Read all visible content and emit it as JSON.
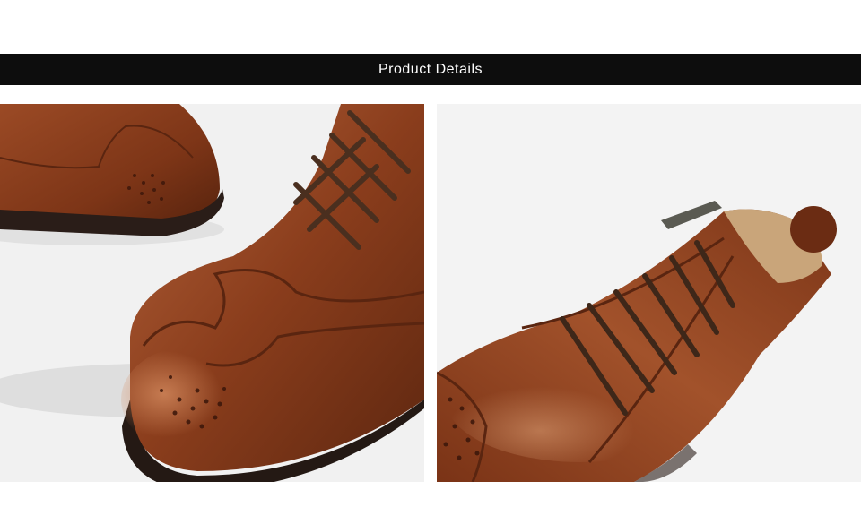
{
  "banner": {
    "title": "Product Details",
    "background_color": "#0d0d0d",
    "text_color": "#ffffff"
  },
  "photos": [
    {
      "name": "brogue-toe-closeup",
      "icon": "photo"
    },
    {
      "name": "boot-lacing-side-view",
      "icon": "photo"
    }
  ],
  "colors": {
    "leather": "#8a3d1c",
    "leather_highlight": "#b5643a",
    "sole": "#2a1d18",
    "lace": "#4a2f1f",
    "lining": "#c9a57a"
  }
}
